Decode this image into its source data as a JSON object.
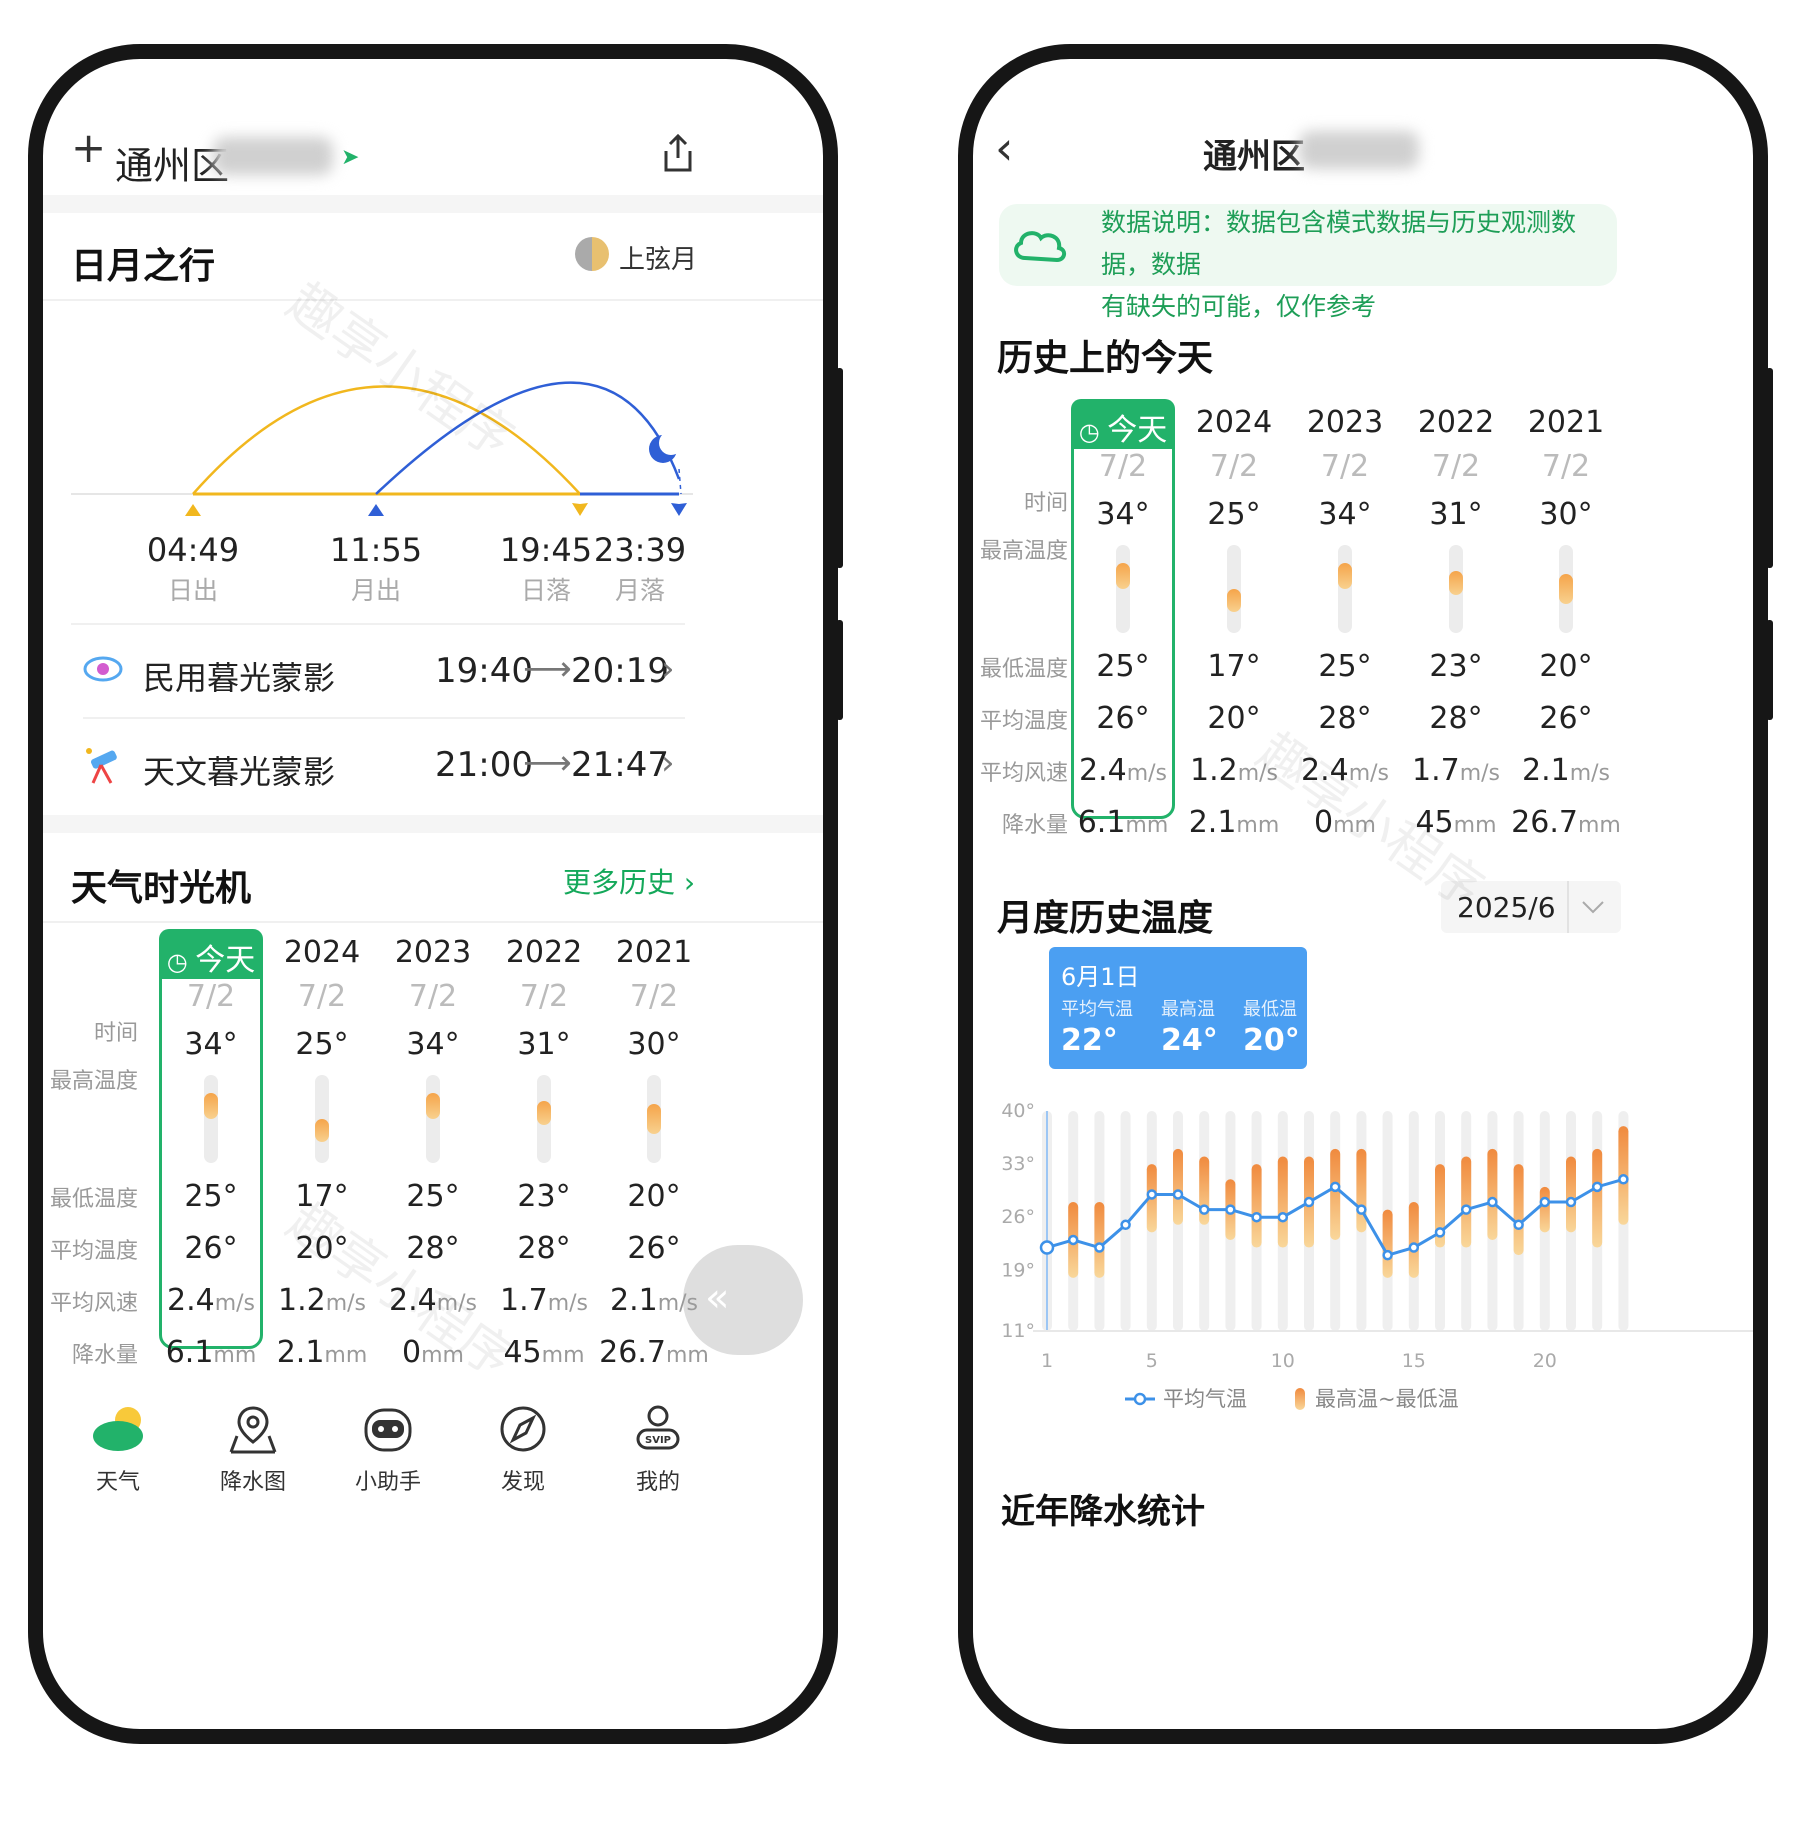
{
  "left": {
    "header": {
      "city": "通州区"
    },
    "sun_moon": {
      "title": "日月之行",
      "moon_phase": "上弦月",
      "events": [
        {
          "time": "04:49",
          "label": "日出"
        },
        {
          "time": "11:55",
          "label": "月出"
        },
        {
          "time": "19:45",
          "label": "日落"
        },
        {
          "time": "23:39",
          "label": "月落"
        }
      ],
      "twilight": [
        {
          "name": "民用暮光蒙影",
          "start": "19:40",
          "end": "20:19"
        },
        {
          "name": "天文暮光蒙影",
          "start": "21:00",
          "end": "21:47"
        }
      ]
    },
    "time_machine": {
      "title": "天气时光机",
      "more": "更多历史"
    },
    "nav": [
      {
        "label": "天气",
        "icon": "weather-cloud-icon"
      },
      {
        "label": "降水图",
        "icon": "map-pin-icon"
      },
      {
        "label": "小助手",
        "icon": "assistant-robot-icon"
      },
      {
        "label": "发现",
        "icon": "compass-icon"
      },
      {
        "label": "我的",
        "icon": "user-svip-icon"
      }
    ],
    "svip": "SVIP",
    "watermark": "趣享小程序"
  },
  "history": {
    "today_label": "今天",
    "row_labels": {
      "time": "时间",
      "high": "最高温度",
      "low": "最低温度",
      "avg": "平均温度",
      "wind": "平均风速",
      "rain": "降水量"
    },
    "units": {
      "wind": "m/s",
      "rain": "mm"
    },
    "columns": [
      {
        "year": "",
        "date": "7/2",
        "high": "34°",
        "low": "25°",
        "avg": "26°",
        "wind": "2.4",
        "rain": "6.1",
        "hi": 34,
        "lo": 25
      },
      {
        "year": "2024",
        "date": "7/2",
        "high": "25°",
        "low": "17°",
        "avg": "20°",
        "wind": "1.2",
        "rain": "2.1",
        "hi": 25,
        "lo": 17
      },
      {
        "year": "2023",
        "date": "7/2",
        "high": "34°",
        "low": "25°",
        "avg": "28°",
        "wind": "2.4",
        "rain": "0",
        "hi": 34,
        "lo": 25
      },
      {
        "year": "2022",
        "date": "7/2",
        "high": "31°",
        "low": "23°",
        "avg": "28°",
        "wind": "1.7",
        "rain": "45",
        "hi": 31,
        "lo": 23
      },
      {
        "year": "2021",
        "date": "7/2",
        "high": "30°",
        "low": "20°",
        "avg": "26°",
        "wind": "2.1",
        "rain": "26.7",
        "hi": 30,
        "lo": 20
      }
    ]
  },
  "right": {
    "header": {
      "city": "通州区"
    },
    "note": {
      "line1": "数据说明：数据包含模式数据与历史观测数据，数据",
      "line2": "有缺失的可能，仅作参考"
    },
    "history_title": "历史上的今天",
    "monthly": {
      "title": "月度历史温度",
      "month_select": "2025/6",
      "tooltip": {
        "date": "6月1日",
        "avg_label": "平均气温",
        "high_label": "最高温",
        "low_label": "最低温",
        "avg": "22°",
        "high": "24°",
        "low": "20°"
      },
      "bottom_cut": "近年降水统计"
    }
  },
  "chart_data": {
    "type": "line",
    "title": "",
    "xlabel": "",
    "ylabel": "",
    "ylim": [
      11,
      40
    ],
    "yticks": [
      "40°",
      "33°",
      "26°",
      "19°",
      "11°"
    ],
    "xticks": [
      "1",
      "5",
      "10",
      "15",
      "20"
    ],
    "x": [
      1,
      2,
      3,
      4,
      5,
      6,
      7,
      8,
      9,
      10,
      11,
      12,
      13,
      14,
      15,
      16,
      17,
      18,
      19,
      20,
      21,
      22,
      23
    ],
    "series": [
      {
        "name": "平均气温",
        "values": [
          22,
          23,
          22,
          25,
          29,
          29,
          27,
          27,
          26,
          26,
          28,
          30,
          27,
          21,
          22,
          24,
          27,
          28,
          25,
          28,
          28,
          30,
          31
        ]
      },
      {
        "name": "最高温~最低温",
        "type": "range",
        "high": [
          0,
          28,
          28,
          0,
          33,
          35,
          34,
          31,
          33,
          34,
          34,
          35,
          35,
          27,
          28,
          33,
          34,
          35,
          33,
          30,
          34,
          35,
          38
        ],
        "low": [
          0,
          18,
          18,
          0,
          24,
          25,
          25,
          23,
          22,
          22,
          22,
          23,
          24,
          18,
          18,
          22,
          22,
          23,
          21,
          24,
          24,
          22,
          25
        ]
      }
    ],
    "legend": [
      "平均气温",
      "最高温~最低温"
    ],
    "legend_position": "bottom"
  }
}
